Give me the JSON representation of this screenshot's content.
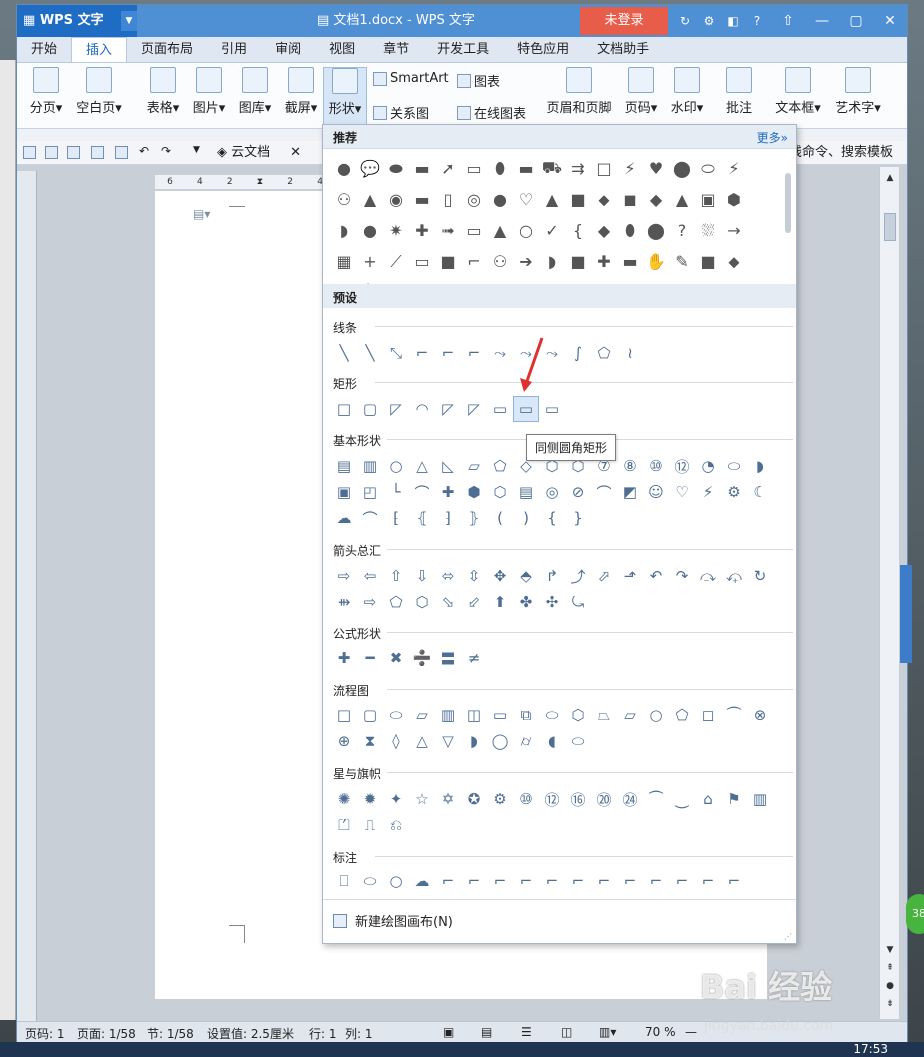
{
  "app": {
    "name": "WPS 文字",
    "window_title": "文档1.docx - WPS 文字",
    "login_label": "未登录"
  },
  "tabs": [
    "开始",
    "插入",
    "页面布局",
    "引用",
    "审阅",
    "视图",
    "章节",
    "开发工具",
    "特色应用",
    "文档助手"
  ],
  "active_tab": "插入",
  "ribbon": {
    "page_break": "分页",
    "blank_page": "空白页",
    "table": "表格",
    "picture": "图片",
    "gallery": "图库",
    "screenshot": "截屏",
    "shapes": "形状",
    "smartart": "SmartArt",
    "relation": "关系图",
    "chart": "图表",
    "online_chart": "在线图表",
    "header_footer": "页眉和页脚",
    "page_number": "页码",
    "watermark": "水印",
    "comment": "批注",
    "textbox": "文本框",
    "wordart": "艺术字"
  },
  "quickbar": {
    "cloud": "云文档",
    "hint": "线命令、搜索模板"
  },
  "shapes_panel": {
    "recommended": "推荐",
    "more": "更多»",
    "preset": "预设",
    "categories": [
      "线条",
      "矩形",
      "基本形状",
      "箭头总汇",
      "公式形状",
      "流程图",
      "星与旗帜",
      "标注"
    ],
    "new_canvas": "新建绘图画布(N)"
  },
  "tooltip": "同侧圆角矩形",
  "ruler": {
    "ticks": [
      "6",
      "4",
      "2",
      "2",
      "4",
      "6"
    ]
  },
  "status": {
    "page_code": "页码: 1",
    "pages": "页面: 1/58",
    "section": "节: 1/58",
    "setting": "设置值: 2.5厘米",
    "row": "行: 1",
    "col": "列: 1",
    "zoom": "70 %"
  },
  "clock": "17:53",
  "watermark_text": "Bai 经验",
  "watermark_url": "jingyan.baidu.com"
}
